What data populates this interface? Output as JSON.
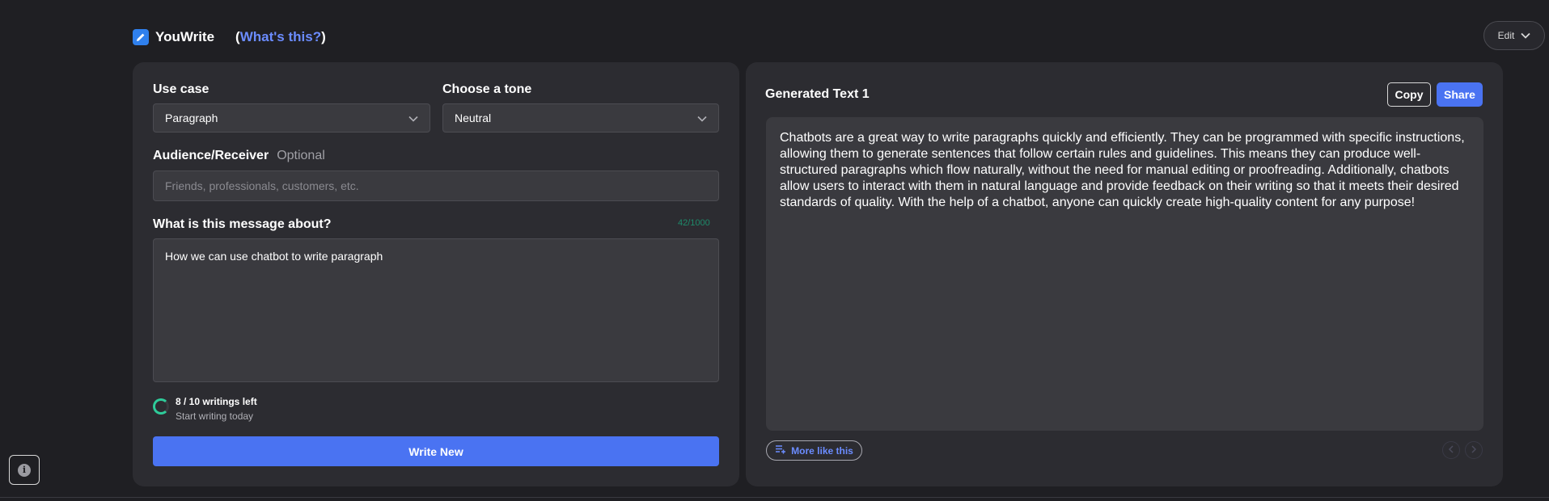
{
  "header": {
    "app_name": "YouWrite",
    "open_paren": "(",
    "whats_this": "What's this?",
    "close_paren": ")",
    "edit_label": "Edit"
  },
  "form": {
    "use_case_label": "Use case",
    "use_case_value": "Paragraph",
    "tone_label": "Choose a tone",
    "tone_value": "Neutral",
    "audience_label": "Audience/Receiver",
    "audience_optional": "Optional",
    "audience_placeholder": "Friends, professionals, customers, etc.",
    "message_label": "What is this message about?",
    "message_counter": "42/1000",
    "message_value": "How we can use chatbot to write paragraph",
    "usage_title": "8 / 10 writings left",
    "usage_sub": "Start writing today",
    "write_button": "Write New"
  },
  "output": {
    "title": "Generated Text 1",
    "copy_label": "Copy",
    "share_label": "Share",
    "text": "Chatbots are a great way to write paragraphs quickly and efficiently. They can be programmed with specific instructions, allowing them to generate sentences that follow certain rules and guidelines. This means they can produce well-structured paragraphs which flow naturally, without the need for manual editing or proofreading. Additionally, chatbots allow users to interact with them in natural language and provide feedback on their writing so that it meets their desired standards of quality. With the help of a chatbot, anyone can quickly create high-quality content for any purpose!",
    "more_like_this": "More like this"
  },
  "colors": {
    "accent": "#4a73f2",
    "link": "#6b8cff",
    "counter": "#1e8a6a",
    "usage_ring": "#2ecc9a"
  },
  "icons": {
    "logo": "pencil-icon",
    "edit_chevron": "chevron-down-icon",
    "select_chevron": "chevron-down-icon",
    "more_like_this": "playlist-add-icon",
    "prev": "chevron-left-icon",
    "next": "chevron-right-icon",
    "info": "info-icon"
  }
}
